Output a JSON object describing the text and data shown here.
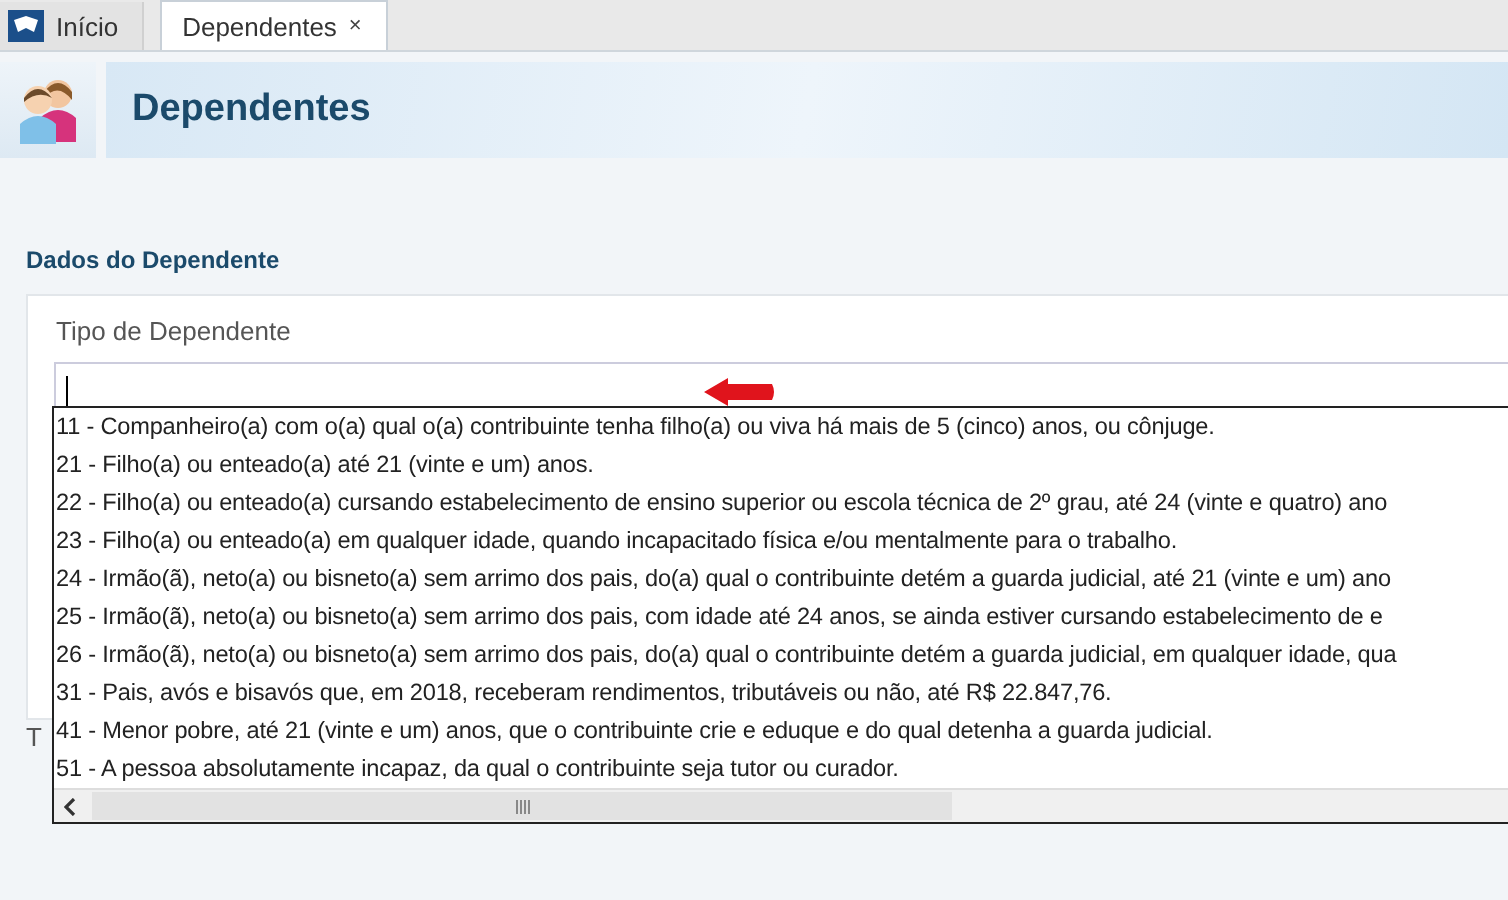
{
  "tabs": [
    {
      "label": "Início",
      "selected": false
    },
    {
      "label": "Dependentes",
      "selected": true,
      "close_label": "×"
    }
  ],
  "header": {
    "title": "Dependentes"
  },
  "section": {
    "title": "Dados do Dependente",
    "field": {
      "label": "Tipo de Dependente",
      "focused": true,
      "options": [
        "11 - Companheiro(a) com o(a) qual o(a) contribuinte tenha filho(a) ou viva há mais de 5 (cinco) anos, ou cônjuge.",
        "21 - Filho(a) ou enteado(a) até 21 (vinte e um) anos.",
        "22 - Filho(a) ou enteado(a) cursando estabelecimento de ensino superior ou escola técnica de 2º grau, até 24 (vinte e quatro) ano",
        "23 - Filho(a) ou enteado(a) em qualquer idade, quando incapacitado física e/ou mentalmente para o trabalho.",
        "24 - Irmão(ã), neto(a) ou bisneto(a) sem arrimo dos pais, do(a) qual o contribuinte detém a guarda judicial, até 21 (vinte e um) ano",
        "25 - Irmão(ã), neto(a) ou bisneto(a) sem arrimo dos pais, com idade até 24 anos, se ainda estiver cursando estabelecimento de e",
        "26 - Irmão(ã), neto(a) ou bisneto(a) sem arrimo dos pais, do(a) qual o contribuinte detém a guarda judicial, em qualquer idade, qua",
        "31 - Pais, avós e bisavós que, em 2018, receberam rendimentos, tributáveis ou não, até R$ 22.847,76.",
        "41 - Menor pobre, até 21 (vinte e um) anos, que o contribuinte crie e eduque e do qual detenha a guarda judicial.",
        "51 - A pessoa absolutamente incapaz, da qual o contribuinte seja tutor ou curador."
      ]
    }
  },
  "footer_label": "T"
}
